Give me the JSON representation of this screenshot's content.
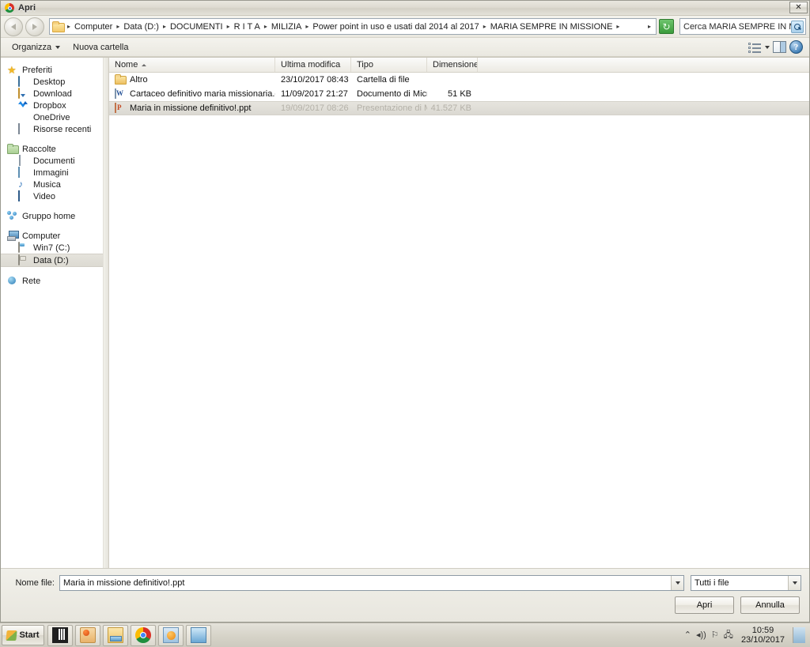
{
  "window": {
    "title": "Apri",
    "title_icon": "chrome-icon",
    "close_label": "✕"
  },
  "address_bar": {
    "back_icon": "back-arrow-icon",
    "forward_icon": "forward-arrow-icon",
    "folder_icon": "folder-icon",
    "breadcrumb": [
      "Computer",
      "Data (D:)",
      "DOCUMENTI",
      "R I T A",
      "MILIZIA",
      "Power point in uso e usati dal 2014 al 2017",
      "MARIA SEMPRE IN MISSIONE"
    ],
    "separator": "▸",
    "dropdown_icon": "chevron-down-icon",
    "refresh_icon": "refresh-icon",
    "refresh_glyph": "↻",
    "search_placeholder": "Cerca MARIA SEMPRE IN MIS...",
    "search_icon": "search-icon"
  },
  "toolbar": {
    "organize_label": "Organizza",
    "new_folder_label": "Nuova cartella",
    "view_icon": "view-mode-icon",
    "view_dropdown_icon": "chevron-down-icon",
    "preview_pane_icon": "preview-pane-icon",
    "help_icon": "help-icon",
    "help_glyph": "?"
  },
  "sidebar": {
    "groups": [
      {
        "header": {
          "label": "Preferiti",
          "icon": "star-icon"
        },
        "items": [
          {
            "label": "Desktop",
            "icon": "desktop-icon"
          },
          {
            "label": "Download",
            "icon": "download-icon"
          },
          {
            "label": "Dropbox",
            "icon": "dropbox-icon"
          },
          {
            "label": "OneDrive",
            "icon": "onedrive-icon"
          },
          {
            "label": "Risorse recenti",
            "icon": "recent-places-icon"
          }
        ]
      },
      {
        "header": {
          "label": "Raccolte",
          "icon": "library-folder-icon"
        },
        "items": [
          {
            "label": "Documenti",
            "icon": "documents-icon"
          },
          {
            "label": "Immagini",
            "icon": "pictures-icon"
          },
          {
            "label": "Musica",
            "icon": "music-icon"
          },
          {
            "label": "Video",
            "icon": "video-icon"
          }
        ]
      },
      {
        "header": {
          "label": "Gruppo home",
          "icon": "homegroup-icon"
        },
        "items": []
      },
      {
        "header": {
          "label": "Computer",
          "icon": "computer-icon"
        },
        "items": [
          {
            "label": "Win7 (C:)",
            "icon": "hard-drive-icon",
            "selected": false
          },
          {
            "label": "Data (D:)",
            "icon": "hard-drive-icon",
            "selected": true
          }
        ]
      },
      {
        "header": {
          "label": "Rete",
          "icon": "network-icon"
        },
        "items": []
      }
    ]
  },
  "file_list": {
    "columns": [
      {
        "key": "name",
        "label": "Nome",
        "sorted": "asc"
      },
      {
        "key": "modified",
        "label": "Ultima modifica"
      },
      {
        "key": "type",
        "label": "Tipo"
      },
      {
        "key": "size",
        "label": "Dimensione"
      }
    ],
    "rows": [
      {
        "name": "Altro",
        "modified": "23/10/2017 08:43",
        "type": "Cartella di file",
        "size": "",
        "icon": "folder-icon",
        "selected": false
      },
      {
        "name": "Cartaceo definitivo maria missionaria.doc",
        "modified": "11/09/2017 21:27",
        "type": "Documento di Micro...",
        "size": "51 KB",
        "icon": "word-document-icon",
        "selected": false
      },
      {
        "name": "Maria in missione definitivo!.ppt",
        "modified": "19/09/2017 08:26",
        "type": "Presentazione di Mi...",
        "size": "41.527 KB",
        "icon": "powerpoint-document-icon",
        "selected": true
      }
    ]
  },
  "footer": {
    "filename_label": "Nome file:",
    "filename_value": "Maria in missione definitivo!.ppt",
    "filename_dropdown_icon": "chevron-down-icon",
    "filter_value": "Tutti i file",
    "filter_dropdown_icon": "chevron-down-icon",
    "open_label": "Apri",
    "cancel_label": "Annulla"
  },
  "taskbar": {
    "start_label": "Start",
    "start_icon": "windows-logo-icon",
    "apps": [
      {
        "name": "barcode-app-icon"
      },
      {
        "name": "paint-app-icon"
      },
      {
        "name": "windows-explorer-icon"
      },
      {
        "name": "chrome-browser-icon"
      },
      {
        "name": "media-player-icon"
      },
      {
        "name": "photo-viewer-icon"
      }
    ],
    "tray": {
      "show_hidden_icon": "chevron-up-icon",
      "show_hidden_glyph": "⌃",
      "volume_icon": "speaker-icon",
      "volume_glyph": "◂))",
      "action_center_icon": "flag-icon",
      "action_center_glyph": "⚐",
      "network_icon": "network-tray-icon",
      "network_glyph": "🖧",
      "time": "10:59",
      "date": "23/10/2017",
      "show_desktop_icon": "show-desktop-button"
    }
  }
}
